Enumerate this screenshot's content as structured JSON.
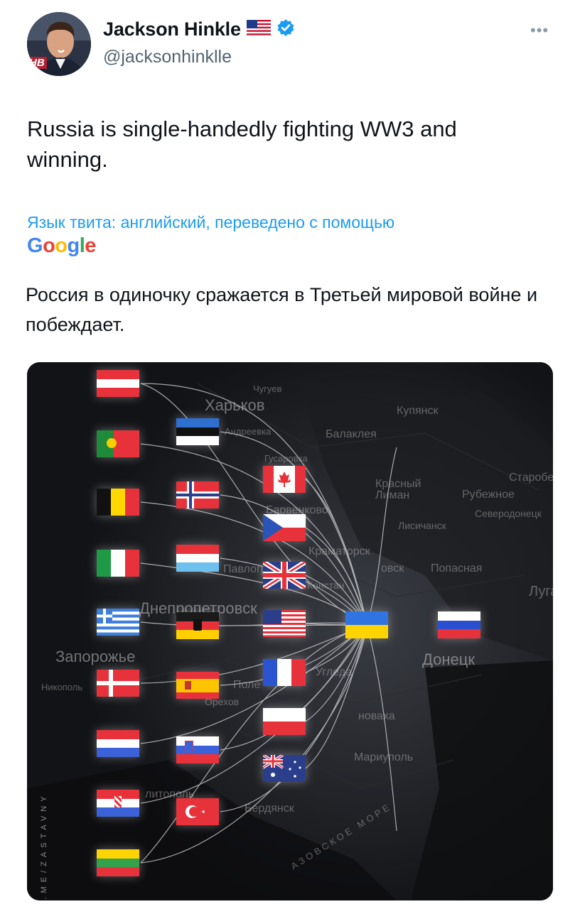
{
  "author": {
    "name": "Jackson Hinkle",
    "handle": "@jacksonhinklle",
    "avatar_badge": "HB",
    "verified_icon": "verified-badge-icon",
    "flag_icon": "us-flag-icon"
  },
  "more_icon": "more-dots-icon",
  "tweet": {
    "text": "Russia is single-handedly fighting WW3 and winning."
  },
  "translation": {
    "label": "Язык твита: английский, переведено с помощью",
    "provider": "Google",
    "text": "Россия в одиночку сражается в Третьей мировой войне и побеждает."
  },
  "media": {
    "watermark": "T.ME/ZASTAVNY",
    "map_labels": {
      "kharkov": "Харьков",
      "chuguev": "Чугуев",
      "kupyansk": "Купянск",
      "balakleya": "Балаклея",
      "andreevka": "Андреевка",
      "gusarovka": "Гусаровка",
      "krasny_liman": "Красный Лиман",
      "rubezhnoe": "Рубежное",
      "starobelsk": "Старобе",
      "severodonetsk": "Северодонецк",
      "barvenkovo": "Барвенково",
      "lisichansk": "Лисичанск",
      "kramatorsk": "Краматорск",
      "pavlograd": "Павлогр",
      "popasnaya": "Попасная",
      "artemovsk": "овск",
      "konstantinovka": "Констан",
      "dnepropetrovsk": "Днепропетровск",
      "lugansk": "Луга",
      "zaporozhe": "Запорожье",
      "donetsk": "Донецк",
      "nikopol": "Никополь",
      "ugledar": "Угледа",
      "pole": "Поле",
      "orekhov": "Орехов",
      "novaya": "новаха",
      "mariupol": "Мариуполь",
      "berdyansk": "Бердянск",
      "melitopol": "литополь",
      "azov_sea": "АЗОВСКОЕ МОРЕ"
    }
  }
}
